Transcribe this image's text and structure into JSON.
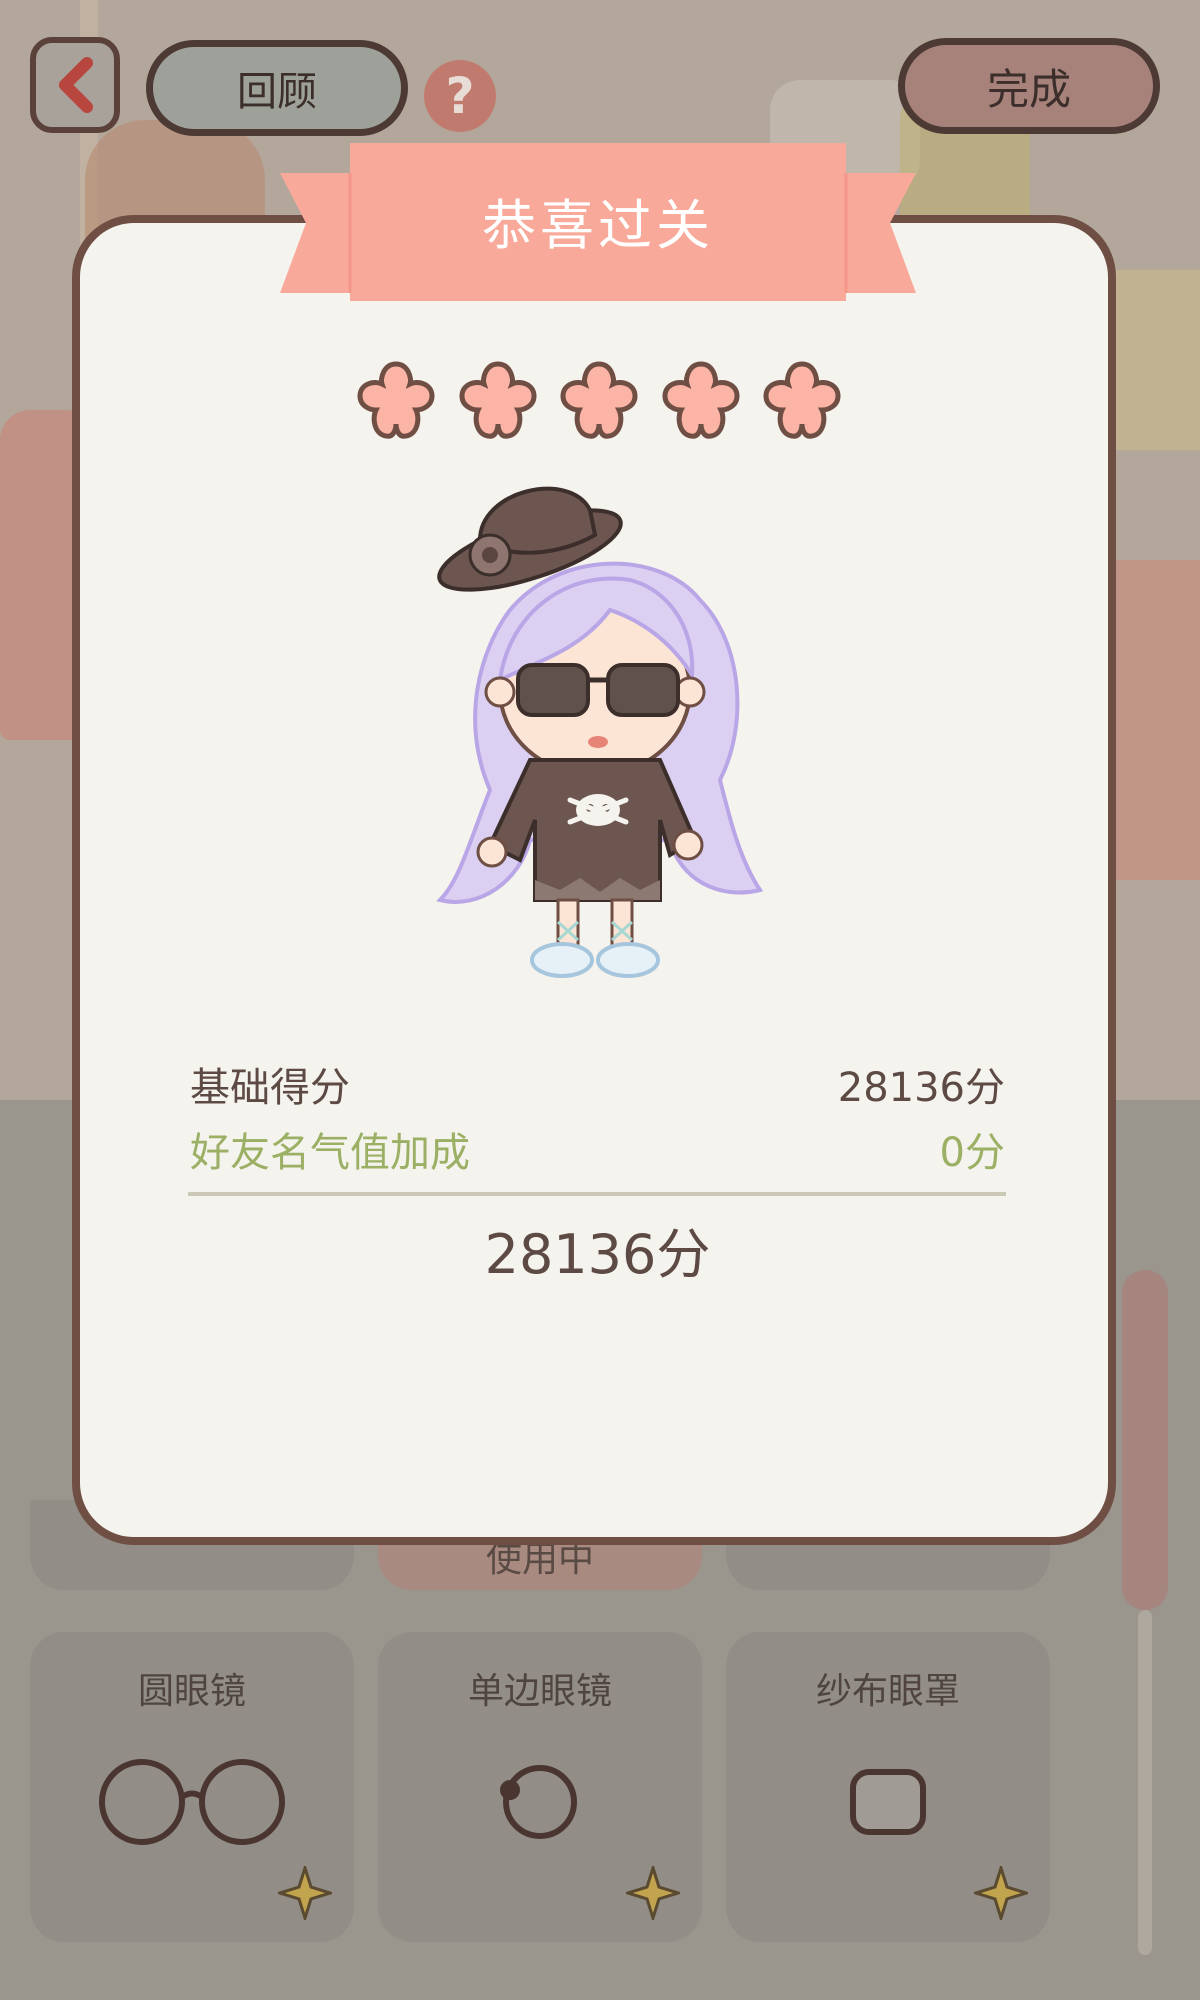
{
  "top_bar": {
    "review_label": "回顾",
    "help_label": "?",
    "done_label": "完成"
  },
  "modal": {
    "title": "恭喜过关",
    "stars_earned": 5,
    "stars_total": 5,
    "base_score_label": "基础得分",
    "base_score_value": "28136分",
    "bonus_label": "好友名气值加成",
    "bonus_value": "0分",
    "total_value": "28136分"
  },
  "items": [
    {
      "label": "圆眼镜",
      "icon": "round-glasses-icon"
    },
    {
      "label": "单边眼镜",
      "icon": "monocle-icon"
    },
    {
      "label": "纱布眼罩",
      "icon": "gauze-eyepatch-icon"
    }
  ],
  "partially_hidden_text": "使用中",
  "colors": {
    "ribbon": "#f9a99a",
    "star": "#fbb4a5",
    "border": "#6f4e44",
    "bonus_text": "#9cb065",
    "modal_bg": "#f5f3ee"
  }
}
